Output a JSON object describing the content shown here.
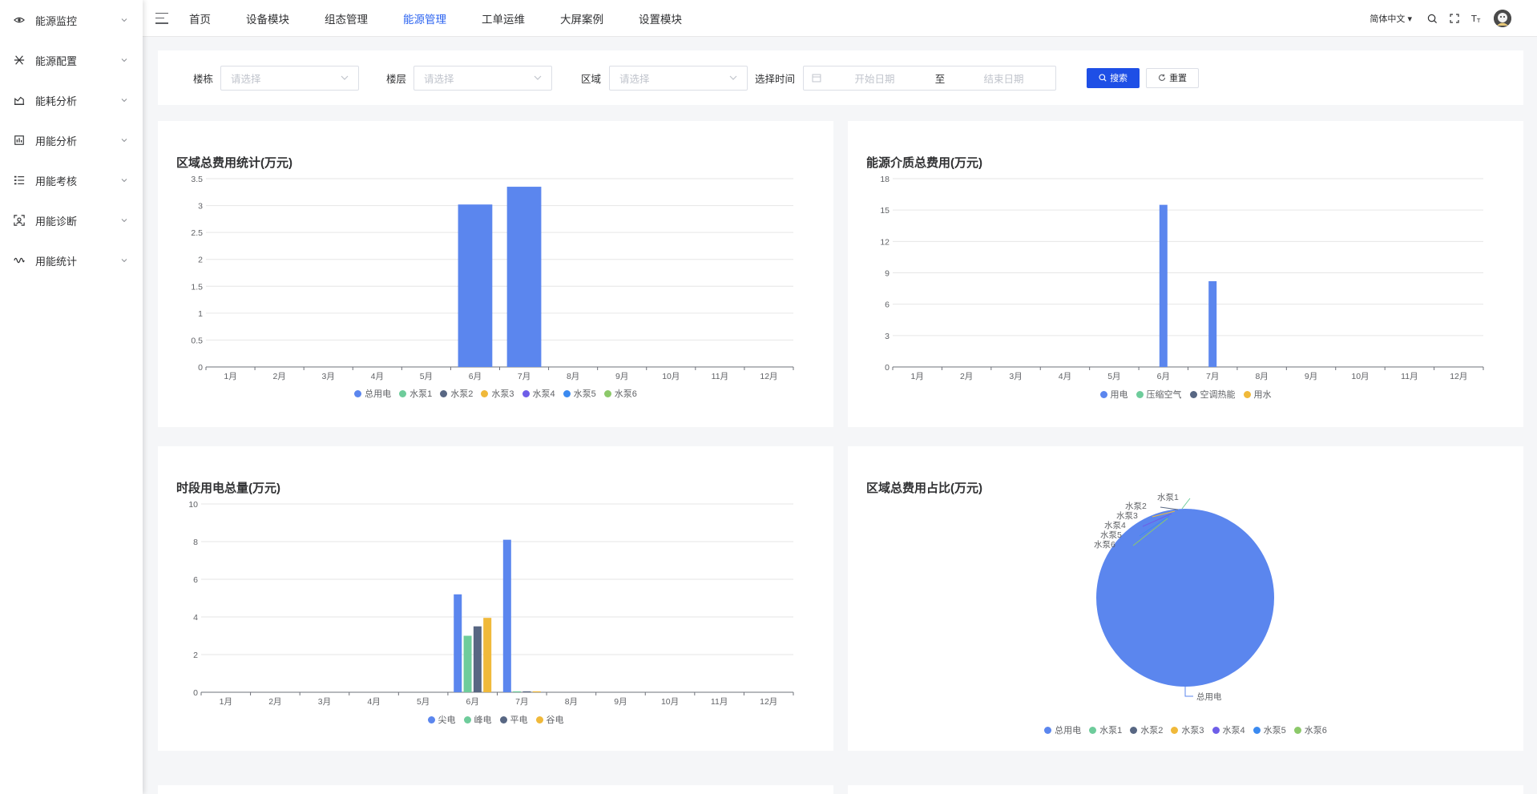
{
  "sidebar": {
    "items": [
      {
        "label": "能源监控",
        "icon": "eye-icon"
      },
      {
        "label": "能源配置",
        "icon": "config-icon"
      },
      {
        "label": "能耗分析",
        "icon": "area-chart-icon"
      },
      {
        "label": "用能分析",
        "icon": "analysis-icon"
      },
      {
        "label": "用能考核",
        "icon": "list-check-icon"
      },
      {
        "label": "用能诊断",
        "icon": "diagnosis-icon"
      },
      {
        "label": "用能统计",
        "icon": "wave-icon"
      }
    ]
  },
  "header": {
    "nav": [
      {
        "label": "首页"
      },
      {
        "label": "设备模块"
      },
      {
        "label": "组态管理"
      },
      {
        "label": "能源管理",
        "active": true
      },
      {
        "label": "工单运维"
      },
      {
        "label": "大屏案例"
      },
      {
        "label": "设置模块"
      }
    ],
    "language": "简体中文"
  },
  "filters": {
    "building_label": "楼栋",
    "building_placeholder": "请选择",
    "floor_label": "楼层",
    "floor_placeholder": "请选择",
    "area_label": "区域",
    "area_placeholder": "请选择",
    "time_label": "选择时间",
    "start_placeholder": "开始日期",
    "range_separator": "至",
    "end_placeholder": "结束日期",
    "search_button": "搜索",
    "reset_button": "重置"
  },
  "colors": {
    "accent": "#2b63f0",
    "primary_button": "#1e4fe6",
    "series": [
      "#5b86ee",
      "#6ecc9b",
      "#586783",
      "#f0b93a",
      "#6e5ee8",
      "#3b8af0",
      "#8cc96a"
    ]
  },
  "cards": {
    "area_cost": {
      "title": "区域总费用统计(万元)"
    },
    "medium_cost": {
      "title": "能源介质总费用(万元)"
    },
    "period_power": {
      "title": "时段用电总量(万元)"
    },
    "area_ratio": {
      "title": "区域总费用占比(万元)"
    }
  },
  "chart_data": [
    {
      "type": "bar",
      "title": "区域总费用统计(万元)",
      "categories": [
        "1月",
        "2月",
        "3月",
        "4月",
        "5月",
        "6月",
        "7月",
        "8月",
        "9月",
        "10月",
        "11月",
        "12月"
      ],
      "yticks": [
        "0",
        "0.5",
        "1",
        "1.5",
        "2",
        "2.5",
        "3",
        "3.5"
      ],
      "ylim": [
        0,
        3.5
      ],
      "grid": true,
      "legend_position": "bottom",
      "series": [
        {
          "name": "总用电",
          "values": [
            0,
            0,
            0,
            0,
            0,
            3.02,
            3.35,
            0,
            0,
            0,
            0,
            0
          ]
        },
        {
          "name": "水泵1",
          "values": [
            0,
            0,
            0,
            0,
            0,
            0,
            0,
            0,
            0,
            0,
            0,
            0
          ]
        },
        {
          "name": "水泵2",
          "values": [
            0,
            0,
            0,
            0,
            0,
            0,
            0,
            0,
            0,
            0,
            0,
            0
          ]
        },
        {
          "name": "水泵3",
          "values": [
            0,
            0,
            0,
            0,
            0,
            0,
            0,
            0,
            0,
            0,
            0,
            0
          ]
        },
        {
          "name": "水泵4",
          "values": [
            0,
            0,
            0,
            0,
            0,
            0,
            0,
            0,
            0,
            0,
            0,
            0
          ]
        },
        {
          "name": "水泵5",
          "values": [
            0,
            0,
            0,
            0,
            0,
            0,
            0,
            0,
            0,
            0,
            0,
            0
          ]
        },
        {
          "name": "水泵6",
          "values": [
            0,
            0,
            0,
            0,
            0,
            0,
            0,
            0,
            0,
            0,
            0,
            0
          ]
        }
      ]
    },
    {
      "type": "bar",
      "title": "能源介质总费用(万元)",
      "categories": [
        "1月",
        "2月",
        "3月",
        "4月",
        "5月",
        "6月",
        "7月",
        "8月",
        "9月",
        "10月",
        "11月",
        "12月"
      ],
      "yticks": [
        "0",
        "3",
        "6",
        "9",
        "12",
        "15",
        "18"
      ],
      "ylim": [
        0,
        18
      ],
      "grid": true,
      "legend_position": "bottom",
      "series": [
        {
          "name": "用电",
          "values": [
            0,
            0,
            0,
            0,
            0,
            15.5,
            8.2,
            0,
            0,
            0,
            0,
            0
          ]
        },
        {
          "name": "压缩空气",
          "values": [
            0,
            0,
            0,
            0,
            0,
            0,
            0,
            0,
            0,
            0,
            0,
            0
          ]
        },
        {
          "name": "空调热能",
          "values": [
            0,
            0,
            0,
            0,
            0,
            0,
            0,
            0,
            0,
            0,
            0,
            0
          ]
        },
        {
          "name": "用水",
          "values": [
            0,
            0,
            0,
            0,
            0,
            0,
            0,
            0,
            0,
            0,
            0,
            0
          ]
        }
      ]
    },
    {
      "type": "bar",
      "title": "时段用电总量(万元)",
      "categories": [
        "1月",
        "2月",
        "3月",
        "4月",
        "5月",
        "6月",
        "7月",
        "8月",
        "9月",
        "10月",
        "11月",
        "12月"
      ],
      "yticks": [
        "0",
        "2",
        "4",
        "6",
        "8",
        "10"
      ],
      "ylim": [
        0,
        10
      ],
      "grid": true,
      "legend_position": "bottom",
      "series": [
        {
          "name": "尖电",
          "values": [
            0,
            0,
            0,
            0,
            0,
            5.2,
            8.1,
            0,
            0,
            0,
            0,
            0
          ]
        },
        {
          "name": "峰电",
          "values": [
            0,
            0,
            0,
            0,
            0,
            3.0,
            0.05,
            0,
            0,
            0,
            0,
            0
          ]
        },
        {
          "name": "平电",
          "values": [
            0,
            0,
            0,
            0,
            0,
            3.5,
            0.05,
            0,
            0,
            0,
            0,
            0
          ]
        },
        {
          "name": "谷电",
          "values": [
            0,
            0,
            0,
            0,
            0,
            3.95,
            0.05,
            0,
            0,
            0,
            0,
            0
          ]
        }
      ]
    },
    {
      "type": "pie",
      "title": "区域总费用占比(万元)",
      "legend_position": "bottom",
      "series": [
        {
          "name": "总用电",
          "value": 6.37
        },
        {
          "name": "水泵1",
          "value": 0
        },
        {
          "name": "水泵2",
          "value": 0
        },
        {
          "name": "水泵3",
          "value": 0
        },
        {
          "name": "水泵4",
          "value": 0
        },
        {
          "name": "水泵5",
          "value": 0
        },
        {
          "name": "水泵6",
          "value": 0
        }
      ]
    }
  ]
}
